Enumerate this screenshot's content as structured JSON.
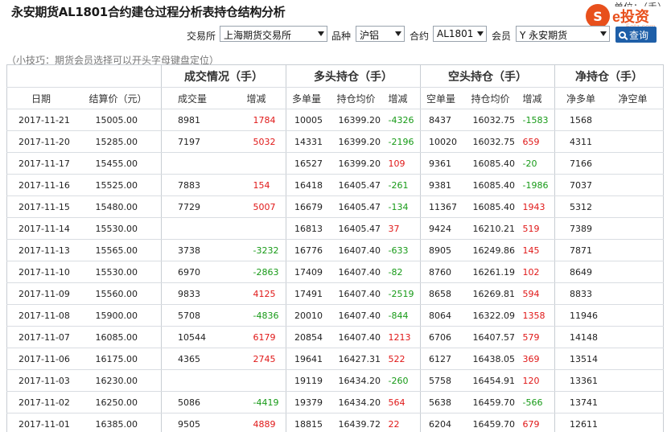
{
  "header": {
    "title": "永安期货AL1801合约建仓过程分析表持仓结构分析",
    "unit_partial": "单位：（手）",
    "logo_text": "e投资",
    "logo_mark": "S",
    "logo_sub": "5etz.com"
  },
  "filters": {
    "exchange_label": "交易所",
    "exchange_value": "上海期货交易所",
    "variety_label": "品种",
    "variety_value": "沪铝",
    "contract_label": "合约",
    "contract_value": "AL1801",
    "member_label": "会员",
    "member_value": "Y 永安期货",
    "search_label": "查询"
  },
  "tip": "（小技巧：期货会员选择可以开头字母键盘定位）",
  "table": {
    "groups": [
      "成交情况（手）",
      "多头持仓（手）",
      "空头持仓（手）",
      "净持仓（手）"
    ],
    "columns": [
      "日期",
      "结算价（元）",
      "成交量",
      "增减",
      "多单量",
      "持仓均价",
      "增减",
      "空单量",
      "持仓均价",
      "增减",
      "净多单",
      "净空单"
    ],
    "rows": [
      [
        "2017-11-21",
        "15005.00",
        "8981",
        "1784",
        "10005",
        "16399.20",
        "-4326",
        "8437",
        "16032.75",
        "-1583",
        "1568",
        ""
      ],
      [
        "2017-11-20",
        "15285.00",
        "7197",
        "5032",
        "14331",
        "16399.20",
        "-2196",
        "10020",
        "16032.75",
        "659",
        "4311",
        ""
      ],
      [
        "2017-11-17",
        "15455.00",
        "",
        "",
        "16527",
        "16399.20",
        "109",
        "9361",
        "16085.40",
        "-20",
        "7166",
        ""
      ],
      [
        "2017-11-16",
        "15525.00",
        "7883",
        "154",
        "16418",
        "16405.47",
        "-261",
        "9381",
        "16085.40",
        "-1986",
        "7037",
        ""
      ],
      [
        "2017-11-15",
        "15480.00",
        "7729",
        "5007",
        "16679",
        "16405.47",
        "-134",
        "11367",
        "16085.40",
        "1943",
        "5312",
        ""
      ],
      [
        "2017-11-14",
        "15530.00",
        "",
        "",
        "16813",
        "16405.47",
        "37",
        "9424",
        "16210.21",
        "519",
        "7389",
        ""
      ],
      [
        "2017-11-13",
        "15565.00",
        "3738",
        "-3232",
        "16776",
        "16407.40",
        "-633",
        "8905",
        "16249.86",
        "145",
        "7871",
        ""
      ],
      [
        "2017-11-10",
        "15530.00",
        "6970",
        "-2863",
        "17409",
        "16407.40",
        "-82",
        "8760",
        "16261.19",
        "102",
        "8649",
        ""
      ],
      [
        "2017-11-09",
        "15560.00",
        "9833",
        "4125",
        "17491",
        "16407.40",
        "-2519",
        "8658",
        "16269.81",
        "594",
        "8833",
        ""
      ],
      [
        "2017-11-08",
        "15900.00",
        "5708",
        "-4836",
        "20010",
        "16407.40",
        "-844",
        "8064",
        "16322.09",
        "1358",
        "11946",
        ""
      ],
      [
        "2017-11-07",
        "16085.00",
        "10544",
        "6179",
        "20854",
        "16407.40",
        "1213",
        "6706",
        "16407.57",
        "579",
        "14148",
        ""
      ],
      [
        "2017-11-06",
        "16175.00",
        "4365",
        "2745",
        "19641",
        "16427.31",
        "522",
        "6127",
        "16438.05",
        "369",
        "13514",
        ""
      ],
      [
        "2017-11-03",
        "16230.00",
        "",
        "",
        "19119",
        "16434.20",
        "-260",
        "5758",
        "16454.91",
        "120",
        "13361",
        ""
      ],
      [
        "2017-11-02",
        "16250.00",
        "5086",
        "-4419",
        "19379",
        "16434.20",
        "564",
        "5638",
        "16459.70",
        "-566",
        "13741",
        ""
      ],
      [
        "2017-11-01",
        "16385.00",
        "9505",
        "4889",
        "18815",
        "16439.72",
        "22",
        "6204",
        "16459.70",
        "679",
        "12611",
        ""
      ]
    ]
  },
  "colors": {
    "positive": "#e01818",
    "negative": "#179a17",
    "accent": "#1f5fa8",
    "logo": "#e8501c"
  }
}
